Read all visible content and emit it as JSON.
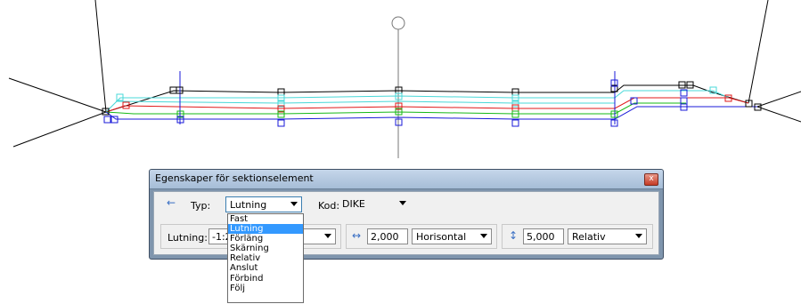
{
  "dialog": {
    "title": "Egenskaper för sektionselement",
    "close_glyph": "x"
  },
  "row1": {
    "type_label": "Typ:",
    "type_value": "Lutning",
    "code_label": "Kod:",
    "code_value": "DIKE"
  },
  "row2": {
    "slope_label": "Lutning:",
    "slope_value": "-1:2",
    "horizontal_value": "2,000",
    "horizontal_mode": "Horisontal",
    "vertical_value": "5,000",
    "vertical_mode": "Relativ"
  },
  "type_options": [
    "Fast",
    "Lutning",
    "Förläng",
    "Skärning",
    "Relativ",
    "Anslut",
    "Förbind",
    "Följ"
  ],
  "type_selected": "Lutning",
  "icons": {
    "back": "arrow-left-icon",
    "horizontal": "horizontal-arrows-icon",
    "vertical": "vertical-arrows-icon"
  },
  "colors": {
    "cyan_line": "#48d8d8",
    "green_line": "#16b816",
    "red_line": "#e01818",
    "blue_line": "#1818d8",
    "title_bar": "#b9cce2",
    "selection": "#3399ff"
  }
}
